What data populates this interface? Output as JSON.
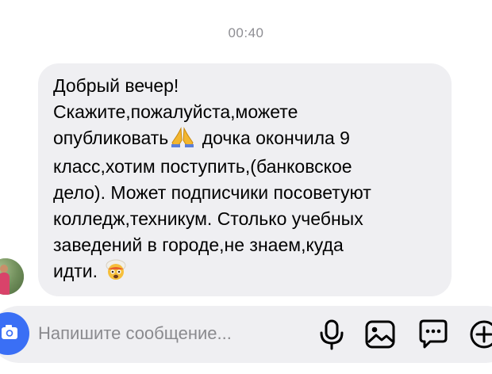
{
  "timestamp": "00:40",
  "message": {
    "lines": [
      "Добрый вечер!",
      "Скажите,пожалуйста,можете",
      "опубликовать",
      "дочка окончила 9",
      "класс,хотим поступить,(банковское",
      "дело). Может подписчики посоветуют",
      "колледж,техникум. Столько учебных",
      "заведений в городе,не знаем,куда",
      "идти."
    ],
    "emojis": [
      "folded-hands-emoji",
      "exploding-head-emoji"
    ]
  },
  "composer": {
    "placeholder": "Напишите сообщение..."
  },
  "icons": {
    "camera": "camera-icon",
    "mic": "microphone-icon",
    "gallery": "gallery-icon",
    "sticker": "sticker-icon",
    "plus": "plus-icon"
  },
  "colors": {
    "bubble": "#efeff2",
    "accent": "#3a6ff5",
    "text": "#000000",
    "muted": "#8e8e93"
  }
}
